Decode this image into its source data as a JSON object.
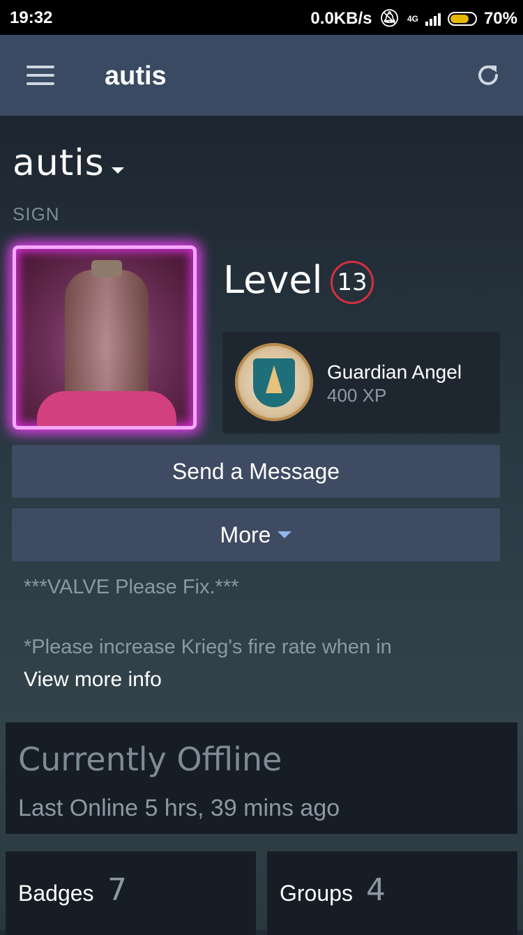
{
  "status_bar": {
    "time": "19:32",
    "net_speed": "0.0KB/s",
    "network": "4G",
    "battery": "70%",
    "battery_level": 0.7
  },
  "app_bar": {
    "title": "autis",
    "menu_icon": "hamburger-menu-icon",
    "refresh_icon": "refresh-icon"
  },
  "profile": {
    "username": "autis",
    "subtitle": "SIGN",
    "level_label": "Level",
    "level": "13",
    "badge": {
      "name": "Guardian Angel",
      "xp": "400 XP"
    },
    "buttons": {
      "send_message": "Send a Message",
      "more": "More"
    },
    "summary_line1": "***VALVE Please Fix.***",
    "summary_line2": "*Please increase Krieg's fire rate when in",
    "view_more": "View more info"
  },
  "status": {
    "title": "Currently Offline",
    "last_online": "Last Online 5 hrs, 39 mins ago"
  },
  "stats": {
    "badges": {
      "label": "Badges",
      "count": "7"
    },
    "groups": {
      "label": "Groups",
      "count": "4"
    }
  },
  "colors": {
    "appbar": "#3a4a63",
    "button": "#3f4b62",
    "level_ring": "#d6303f",
    "avatar_glow": "#e040e8"
  }
}
